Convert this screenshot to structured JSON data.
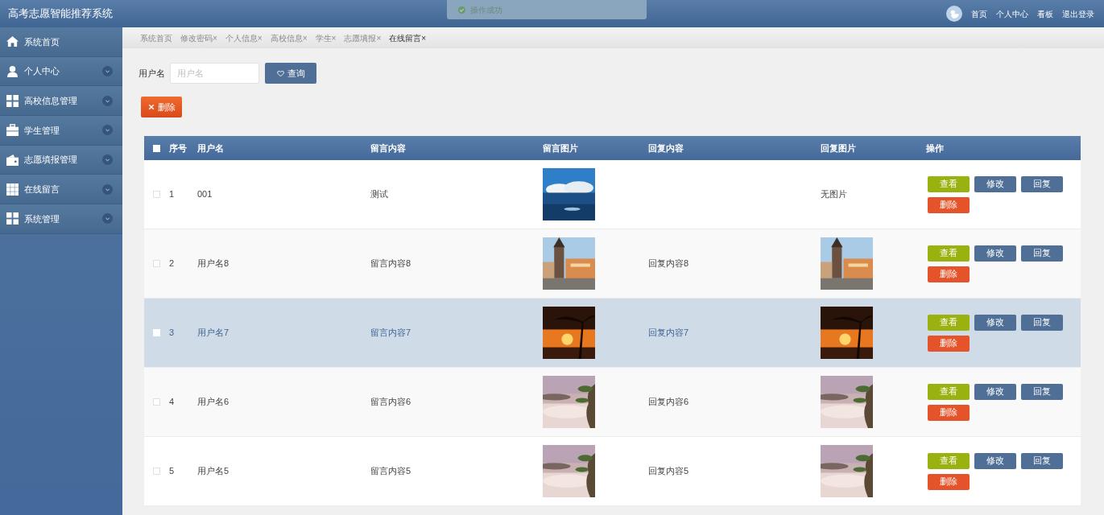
{
  "header": {
    "title": "高考志愿智能推荐系统",
    "nav": [
      "首页",
      "个人中心",
      "看板",
      "退出登录"
    ]
  },
  "toast": {
    "text": "操作成功"
  },
  "sidebar": {
    "items": [
      {
        "label": "系统首页",
        "has_submenu": false
      },
      {
        "label": "个人中心",
        "has_submenu": true
      },
      {
        "label": "高校信息管理",
        "has_submenu": true
      },
      {
        "label": "学生管理",
        "has_submenu": true
      },
      {
        "label": "志愿填报管理",
        "has_submenu": true
      },
      {
        "label": "在线留言",
        "has_submenu": true
      },
      {
        "label": "系统管理",
        "has_submenu": true
      }
    ]
  },
  "tabs": [
    {
      "label": "系统首页",
      "selected": false
    },
    {
      "label": "修改密码",
      "close": "×",
      "selected": false
    },
    {
      "label": "个人信息",
      "close": "×",
      "selected": false
    },
    {
      "label": "高校信息",
      "close": "×",
      "selected": false
    },
    {
      "label": "学生",
      "close": "×",
      "selected": false
    },
    {
      "label": "志愿填报",
      "close": "×",
      "selected": false
    },
    {
      "label": "在线留言",
      "close": "×",
      "selected": true
    }
  ],
  "search": {
    "label": "用户名",
    "placeholder": "用户名",
    "button": "查询"
  },
  "delete_button": "删除",
  "table": {
    "select_all": {
      "checked": false
    },
    "columns": [
      "序号",
      "用户名",
      "留言内容",
      "留言图片",
      "回复内容",
      "回复图片",
      "操作"
    ],
    "rows": [
      {
        "selected": false,
        "number": "1",
        "username": "001",
        "message": "测试",
        "message_image": {
          "kind": "picture"
        },
        "reply_image": {
          "kind": "text",
          "text": "无图片"
        },
        "actions": [
          "查看",
          "修改",
          "回复",
          "删除"
        ]
      },
      {
        "selected": false,
        "number": "2",
        "username": "用户名8",
        "message": "留言内容8",
        "message_image": {
          "kind": "picture"
        },
        "reply": "回复内容8",
        "reply_image": {
          "kind": "picture"
        },
        "actions": [
          "查看",
          "修改",
          "回复",
          "删除"
        ]
      },
      {
        "selected": true,
        "number": "3",
        "username": "用户名7",
        "message": "留言内容7",
        "message_image": {
          "kind": "picture"
        },
        "reply": "回复内容7",
        "reply_image": {
          "kind": "picture"
        },
        "actions": [
          "查看",
          "修改",
          "回复",
          "删除"
        ]
      },
      {
        "selected": false,
        "number": "4",
        "username": "用户名6",
        "message": "留言内容6",
        "message_image": {
          "kind": "picture"
        },
        "reply": "回复内容6",
        "reply_image": {
          "kind": "picture"
        },
        "actions": [
          "查看",
          "修改",
          "回复",
          "删除"
        ]
      },
      {
        "selected": false,
        "number": "5",
        "username": "用户名5",
        "message": "留言内容5",
        "message_image": {
          "kind": "picture"
        },
        "reply": "回复内容5",
        "reply_image": {
          "kind": "picture"
        },
        "actions": [
          "查看",
          "修改",
          "回复",
          "删除"
        ]
      }
    ]
  }
}
